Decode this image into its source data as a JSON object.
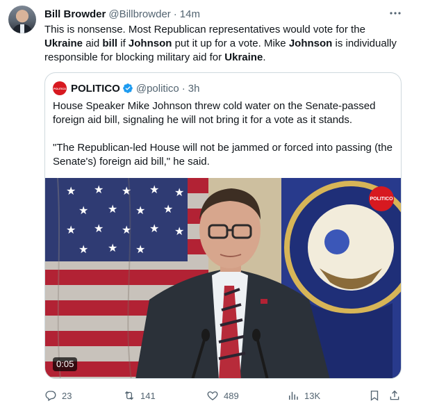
{
  "tweet": {
    "author_name": "Bill Browder",
    "author_handle": "@Billbrowder",
    "separator": "·",
    "time": "14m",
    "text_parts": [
      {
        "t": "This is nonsense. Most Republican representatives would vote for the ",
        "b": false
      },
      {
        "t": "Ukraine",
        "b": true
      },
      {
        "t": " aid ",
        "b": false
      },
      {
        "t": "bill",
        "b": true
      },
      {
        "t": " if ",
        "b": false
      },
      {
        "t": "Johnson",
        "b": true
      },
      {
        "t": " put it up for a vote. Mike ",
        "b": false
      },
      {
        "t": "Johnson",
        "b": true
      },
      {
        "t": " is individually responsible for blocking military aid for ",
        "b": false
      },
      {
        "t": "Ukraine",
        "b": true
      },
      {
        "t": ".",
        "b": false
      }
    ],
    "more_icon": "more-dots-icon"
  },
  "quote": {
    "avatar_text": "POLITICO",
    "author_name": "POLITICO",
    "verified_icon": "verified-badge-icon",
    "author_handle": "@politico",
    "separator": "·",
    "time": "3h",
    "paragraph_1": "House Speaker Mike Johnson threw cold water on the Senate-passed foreign aid bill, signaling he will not bring it for a vote as it stands.",
    "paragraph_2": "\"The Republican-led House will not be jammed or forced into passing (the Senate's) foreign aid bill,\" he said.",
    "media": {
      "video_time": "0:05",
      "brand_badge": "POLITICO"
    }
  },
  "actions": {
    "reply_count": "23",
    "retweet_count": "141",
    "like_count": "489",
    "views_count": "13K",
    "icons": [
      "reply-icon",
      "retweet-icon",
      "like-icon",
      "views-icon",
      "bookmark-icon",
      "share-icon"
    ]
  },
  "colors": {
    "text": "#0f1419",
    "muted": "#536471",
    "border": "#cfd9de",
    "verified": "#1d9bf0",
    "politico_red": "#d71920"
  }
}
